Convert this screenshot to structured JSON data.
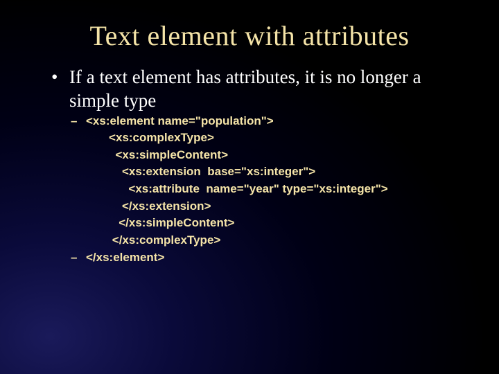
{
  "slide": {
    "title": "Text element with attributes",
    "bullet1": "If a text element has attributes, it is no longer a simple type",
    "code": {
      "l1": "<xs:element  name=\"population\">",
      "l2": "       <xs:complexType>",
      "l3": "         <xs:simpleContent>",
      "l4": "           <xs:extension  base=\"xs:integer\">",
      "l5": "             <xs:attribute  name=\"year\" type=\"xs:integer\">",
      "l6": "           </xs:extension>",
      "l7": "          </xs:simpleContent>",
      "l8": "        </xs:complexType>",
      "l9": "</xs:element>"
    }
  }
}
